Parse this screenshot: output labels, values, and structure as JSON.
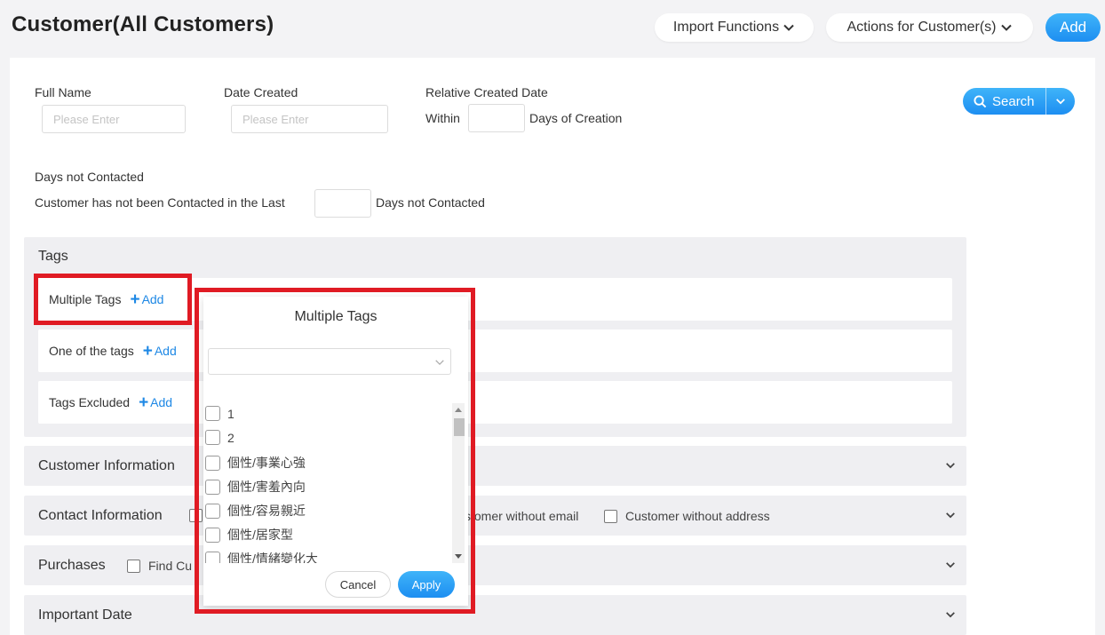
{
  "header": {
    "title": "Customer(All Customers)",
    "import_label": "Import Functions",
    "actions_label": "Actions for Customer(s)",
    "add_label": "Add"
  },
  "filters": {
    "full_name_label": "Full Name",
    "full_name_placeholder": "Please Enter",
    "date_created_label": "Date Created",
    "date_created_placeholder": "Please Enter",
    "relative_label": "Relative Created Date",
    "within_label": "Within",
    "days_creation_label": "Days of Creation",
    "days_not_contacted_label": "Days not Contacted",
    "not_contacted_prefix": "Customer has not been Contacted in the Last",
    "not_contacted_suffix": "Days not Contacted",
    "search_label": "Search"
  },
  "tags": {
    "title": "Tags",
    "multiple_label": "Multiple Tags",
    "one_of_label": "One of the tags",
    "excluded_label": "Tags Excluded",
    "add_label": "Add"
  },
  "sections": {
    "customer_info": "Customer Information",
    "contact_info": "Contact Information",
    "contact_opt_email": "stomer without email",
    "contact_opt_address": "Customer without address",
    "purchases": "Purchases",
    "purchases_opt": "Find Cu",
    "important_date": "Important Date"
  },
  "popup": {
    "title": "Multiple Tags",
    "items": [
      "1",
      "2",
      "個性/事業心強",
      "個性/害羞內向",
      "個性/容易親近",
      "個性/居家型",
      "個性/情緒變化大"
    ],
    "cancel_label": "Cancel",
    "apply_label": "Apply"
  },
  "colors": {
    "accent": "#1d8ef1",
    "highlight": "#e01b24",
    "section_bg": "#efeff2"
  }
}
